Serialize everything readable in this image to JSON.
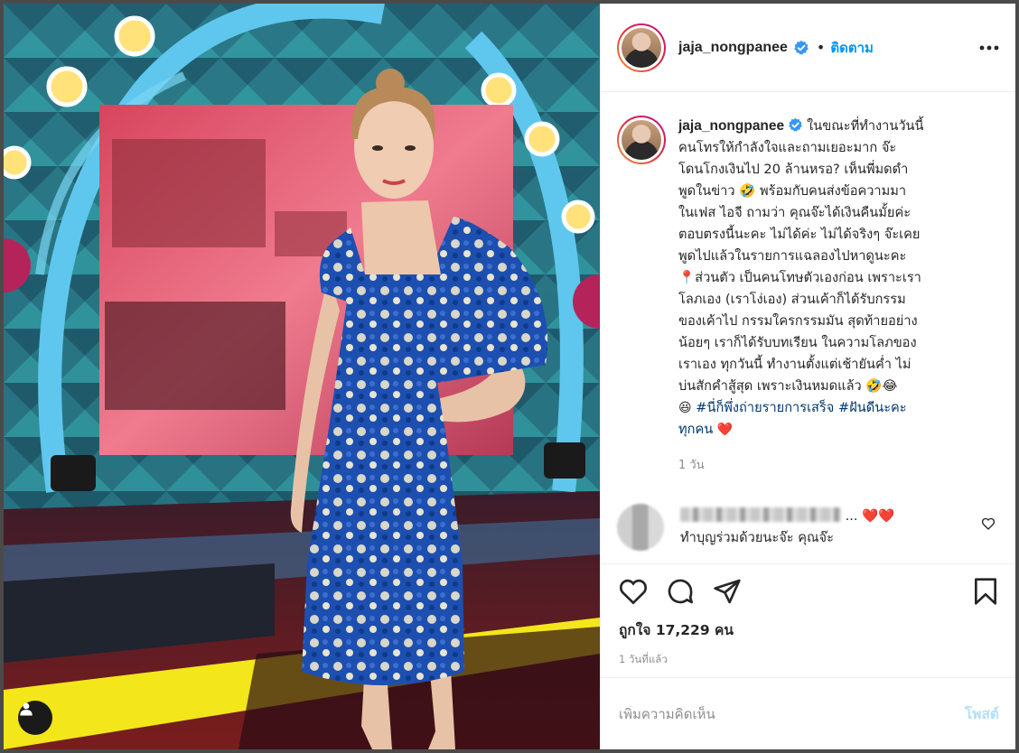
{
  "post": {
    "username": "jaja_nongpanee",
    "follow_label": "ติดตาม",
    "dot": "•",
    "caption_lines": [
      "ในขณะที่ทำงานวันนี้",
      "คนโทรให้กำลังใจและถามเยอะมาก จ๊ะ",
      "โดนโกงเงินไป 20 ล้านหรอ? เห็นพี่มดดำ",
      "พูดในข่าว 🤣 พร้อมกับคนส่งข้อความมา",
      "ในเฟส ไอจี ถามว่า คุณจ๊ะได้เงินคืนมั้ยค่ะ",
      "ตอบตรงนี้นะคะ ไม่ได้ค่ะ ไม่ได้จริงๆ จ๊ะเคย",
      "พูดไปแล้วในรายการแฉลองไปหาดูนะคะ",
      "📍ส่วนตัว เป็นคนโทษตัวเองก่อน เพราะเรา",
      "โลภเอง (เราโง่เอง) ส่วนเค้าก็ได้รับกรรม",
      "ของเค้าไป กรรมใครกรรมมัน สุดท้ายอย่าง",
      "น้อยๆ เราก็ได้รับบทเรียน ในความโลภของ",
      "เราเอง ทุกวันนี้ ทำงานตั้งแต่เช้ายันค่ำ ไม่",
      "บ่นสักคำสู้สุด เพราะเงินหมดแล้ว 🤣😂"
    ],
    "caption_tail_emoji": "😆",
    "hashtag_1": "#นี่ก็พึ่งถ่ายรายการเสร็จ",
    "hashtag_2": "#ฝันดีนะคะ",
    "caption_end": "ทุกคน",
    "caption_end_emoji": "❤️",
    "caption_time": "1 วัน",
    "comment": {
      "hidden_suffix": "...",
      "hearts": "❤️❤️",
      "text": "ทำบุญร่วมด้วยนะจ๊ะ คุณจ๊ะ"
    },
    "likes": "ถูกใจ 17,229 คน",
    "posted": "1 วันที่แล้ว",
    "add_comment_placeholder": "เพิ่มความคิดเห็น",
    "post_button": "โพสต์"
  },
  "colors": {
    "link": "#0095f6",
    "hashtag": "#00376b",
    "text": "#262626",
    "muted": "#8e8e8e",
    "verified": "#3897f0"
  },
  "icons": {
    "verified": "verified-badge-icon",
    "more": "more-options-icon",
    "heart": "heart-icon",
    "comment": "comment-icon",
    "share": "share-icon",
    "save": "bookmark-icon",
    "tag": "user-tag-icon"
  }
}
